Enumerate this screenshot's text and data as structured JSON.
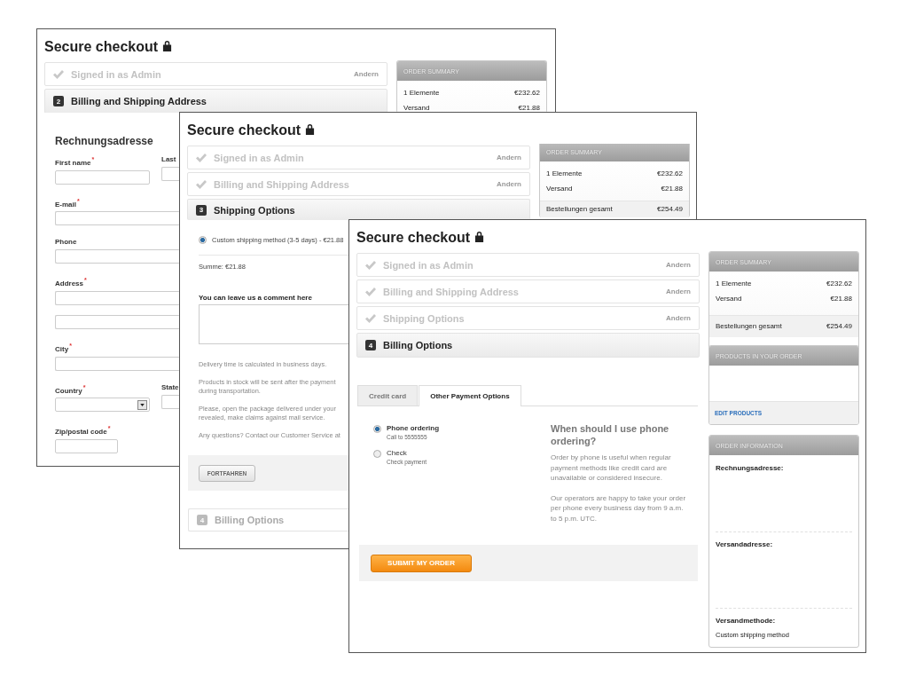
{
  "windows": [
    {
      "title": "Secure checkout",
      "steps": [
        {
          "kind": "done",
          "label": "Signed in as Admin",
          "action": "Andern"
        },
        {
          "kind": "active",
          "number": "2",
          "label": "Billing and Shipping Address"
        }
      ],
      "summary": {
        "title": "ORDER SUMMARY",
        "rows": [
          {
            "label": "1 Elemente",
            "value": "€232.62"
          },
          {
            "label": "Versand",
            "value": "€21.88"
          }
        ]
      },
      "form": {
        "title": "Rechnungsadresse",
        "rows": [
          {
            "fields": [
              {
                "label": "First name",
                "mark": "*",
                "kind": "half"
              },
              {
                "label": "Last",
                "kind": "edge"
              }
            ]
          },
          {
            "fields": [
              {
                "label": "E-mail",
                "mark": "*",
                "kind": "wide"
              }
            ]
          },
          {
            "fields": [
              {
                "label": "Phone",
                "kind": "wide"
              }
            ]
          },
          {
            "fields": [
              {
                "label": "Address",
                "mark": "*",
                "kind": "wide"
              }
            ]
          },
          {
            "fields": [
              {
                "kind": "wide"
              }
            ]
          },
          {
            "fields": [
              {
                "label": "City",
                "mark": "*",
                "kind": "wide"
              }
            ]
          },
          {
            "fields": [
              {
                "label": "Country",
                "mark": "*",
                "kind": "select"
              },
              {
                "label": "State",
                "kind": "edge"
              }
            ]
          },
          {
            "fields": [
              {
                "label": "Zip/postal code",
                "mark": "*",
                "kind": "short"
              }
            ]
          }
        ]
      }
    },
    {
      "title": "Secure checkout",
      "steps": [
        {
          "kind": "done",
          "label": "Signed in as Admin",
          "action": "Andern"
        },
        {
          "kind": "done",
          "label": "Billing and Shipping Address",
          "action": "Andern"
        },
        {
          "kind": "active",
          "number": "3",
          "label": "Shipping Options"
        }
      ],
      "summary": {
        "title": "ORDER SUMMARY",
        "rows": [
          {
            "label": "1 Elemente",
            "value": "€232.62"
          },
          {
            "label": "Versand",
            "value": "€21.88"
          }
        ],
        "total": {
          "label": "Bestellungen gesamt",
          "value": "€254.49"
        }
      },
      "shipping": {
        "methods": [
          {
            "label": "Custom shipping method (3-5 days) - €21.88",
            "selected": true
          }
        ],
        "sum": "Summe: €21.88",
        "comment_label": "You can leave us a comment here",
        "notes": [
          "Delivery time is calculated in business days.",
          "Products in stock will be sent after the payment\nduring transportation.",
          "Please, open the package delivered under your\nrevealed, make claims against mail service.",
          "Any questions? Contact our Customer Service at"
        ],
        "button": "FORTFAHREN"
      },
      "next_step": {
        "kind": "pending",
        "number": "4",
        "label": "Billing Options"
      }
    },
    {
      "title": "Secure checkout",
      "steps": [
        {
          "kind": "done",
          "label": "Signed in as Admin",
          "action": "Andern"
        },
        {
          "kind": "done",
          "label": "Billing and Shipping Address",
          "action": "Andern"
        },
        {
          "kind": "done",
          "label": "Shipping Options",
          "action": "Andern"
        },
        {
          "kind": "active",
          "number": "4",
          "label": "Billing Options"
        }
      ],
      "tabs": [
        {
          "label": "Credit card",
          "selected": false
        },
        {
          "label": "Other Payment Options",
          "selected": true
        }
      ],
      "payment_methods": [
        {
          "label": "Phone ordering",
          "detail": "Call to 5555555",
          "selected": true
        },
        {
          "label": "Check",
          "detail": "Check payment",
          "selected": false
        }
      ],
      "help": {
        "heading": "When should I use phone\nordering?",
        "paragraphs": [
          "Order by phone is useful when regular\npayment methods like credit card are\nunavailable or considered insecure.",
          "Our operators are happy to take your order\nper phone every business day from 9 a.m.\nto 5 p.m. UTC."
        ]
      },
      "submit": "SUBMIT MY ORDER",
      "summary": {
        "title": "ORDER SUMMARY",
        "rows": [
          {
            "label": "1 Elemente",
            "value": "€232.62"
          },
          {
            "label": "Versand",
            "value": "€21.88"
          }
        ],
        "total": {
          "label": "Bestellungen gesamt",
          "value": "€254.49"
        }
      },
      "products": {
        "title": "PRODUCTS IN YOUR ORDER",
        "link": "EDIT PRODUCTS"
      },
      "order_info": {
        "title": "ORDER INFORMATION",
        "sections": [
          {
            "label": "Rechnungsadresse:"
          },
          {
            "label": "Versandadresse:"
          },
          {
            "label": "Versandmethode:",
            "value": "Custom shipping method"
          }
        ]
      }
    }
  ]
}
